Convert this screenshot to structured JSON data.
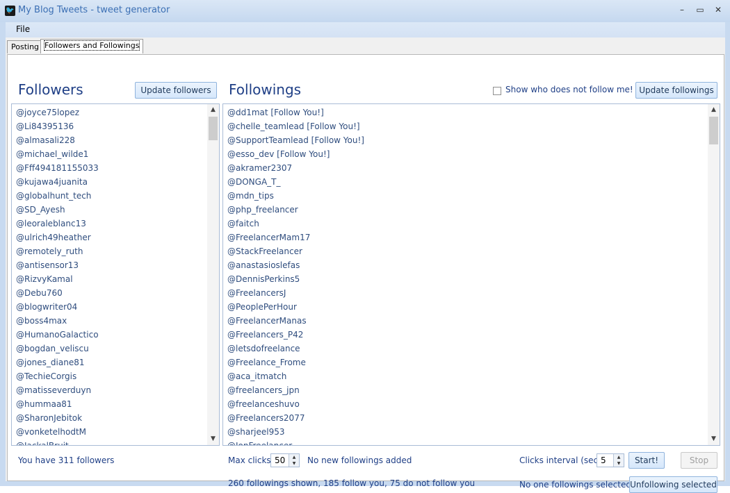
{
  "window": {
    "title": "My Blog Tweets - tweet generator",
    "icon": "twitter-bird-icon"
  },
  "menu": {
    "file": "File"
  },
  "tabs": [
    {
      "label": "Posting",
      "active": false
    },
    {
      "label": "Followers and Followings",
      "active": true
    }
  ],
  "followers": {
    "heading": "Followers",
    "update_button": "Update followers",
    "items": [
      "@joyce75lopez",
      "@Li84395136",
      "@almasali228",
      "@michael_wilde1",
      "@Fff494181155033",
      "@kujawa4juanita",
      "@globalhunt_tech",
      "@SD_Ayesh",
      "@leoraleblanc13",
      "@ulrich49heather",
      "@remotely_ruth",
      "@antisensor13",
      "@RizvyKamal",
      "@Debu760",
      "@blogwriter04",
      "@boss4max",
      "@HumanoGalactico",
      "@bogdan_veliscu",
      "@jones_diane81",
      "@TechieCorgis",
      "@matisseverduyn",
      "@hummaa81",
      "@SharonJebitok",
      "@vonketelhodtM",
      "@JackalBruit"
    ],
    "status": "You have 311 followers"
  },
  "followings": {
    "heading": "Followings",
    "show_not_follow_label": "Show who does not follow me!",
    "show_not_follow_checked": false,
    "update_button": "Update followings",
    "items": [
      "@dd1mat [Follow You!]",
      "@chelle_teamlead [Follow You!]",
      "@SupportTeamlead [Follow You!]",
      "@esso_dev [Follow You!]",
      "@akramer2307",
      "@DONGA_T_",
      "@mdn_tips",
      "@php_freelancer",
      "@faitch",
      "@FreelancerMam17",
      "@StackFreelancer",
      "@anastasioslefas",
      "@DennisPerkins5",
      "@FreelancersJ",
      "@PeoplePerHour",
      "@FreelancerManas",
      "@Freelancers_P42",
      "@letsdofreelance",
      "@Freelance_Frome",
      "@aca_itmatch",
      "@freelancers_jpn",
      "@freelanceshuvo",
      "@Freelancers2077",
      "@sharjeel953",
      "@JonFreelancer"
    ],
    "max_clicks_label": "Max clicks",
    "max_clicks_value": "50",
    "added_status": "No new followings added",
    "clicks_interval_label": "Clicks interval (sec)",
    "clicks_interval_value": "5",
    "start_button": "Start!",
    "stop_button": "Stop",
    "summary": "260 followings shown, 185 follow you, 75 do not follow you",
    "selection_status": "No one followings selected",
    "unfollow_button": "Unfollowing selected"
  }
}
